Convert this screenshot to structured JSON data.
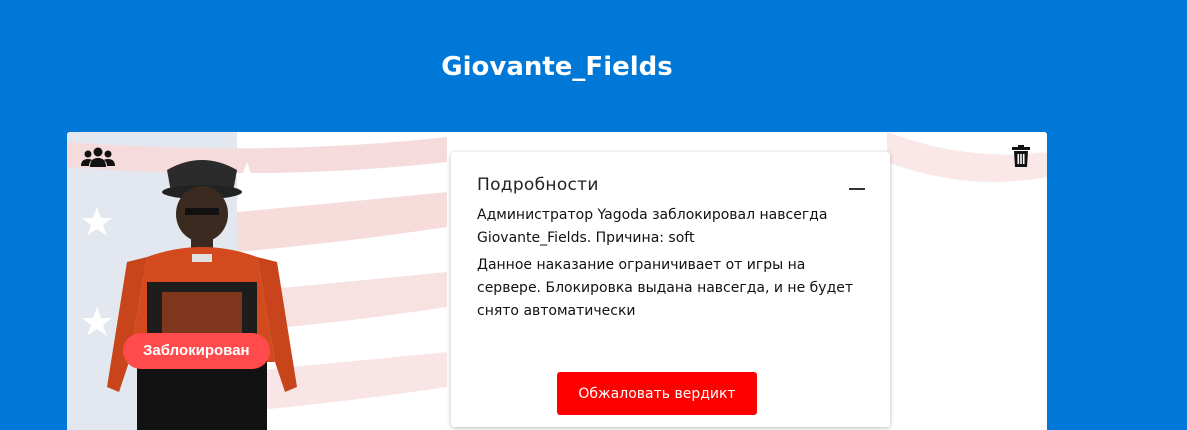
{
  "player": {
    "name": "Giovante_Fields",
    "status": "Заблокирован"
  },
  "details": {
    "title": "Подробности",
    "message": "Администратор Yagoda заблокировал навсегда Giovante_Fields. Причина: soft",
    "description": "Данное наказание ограничивает от игры на сервере. Блокировка выдана навсегда, и не будет снято автоматически",
    "appeal_label": "Обжаловать вердикт"
  },
  "icons": {
    "group": "group-icon",
    "delete": "trash-icon",
    "collapse": "minus-icon"
  },
  "colors": {
    "background": "#0078d7",
    "status_badge": "#ff4b4b",
    "appeal_button": "#ff0000"
  }
}
